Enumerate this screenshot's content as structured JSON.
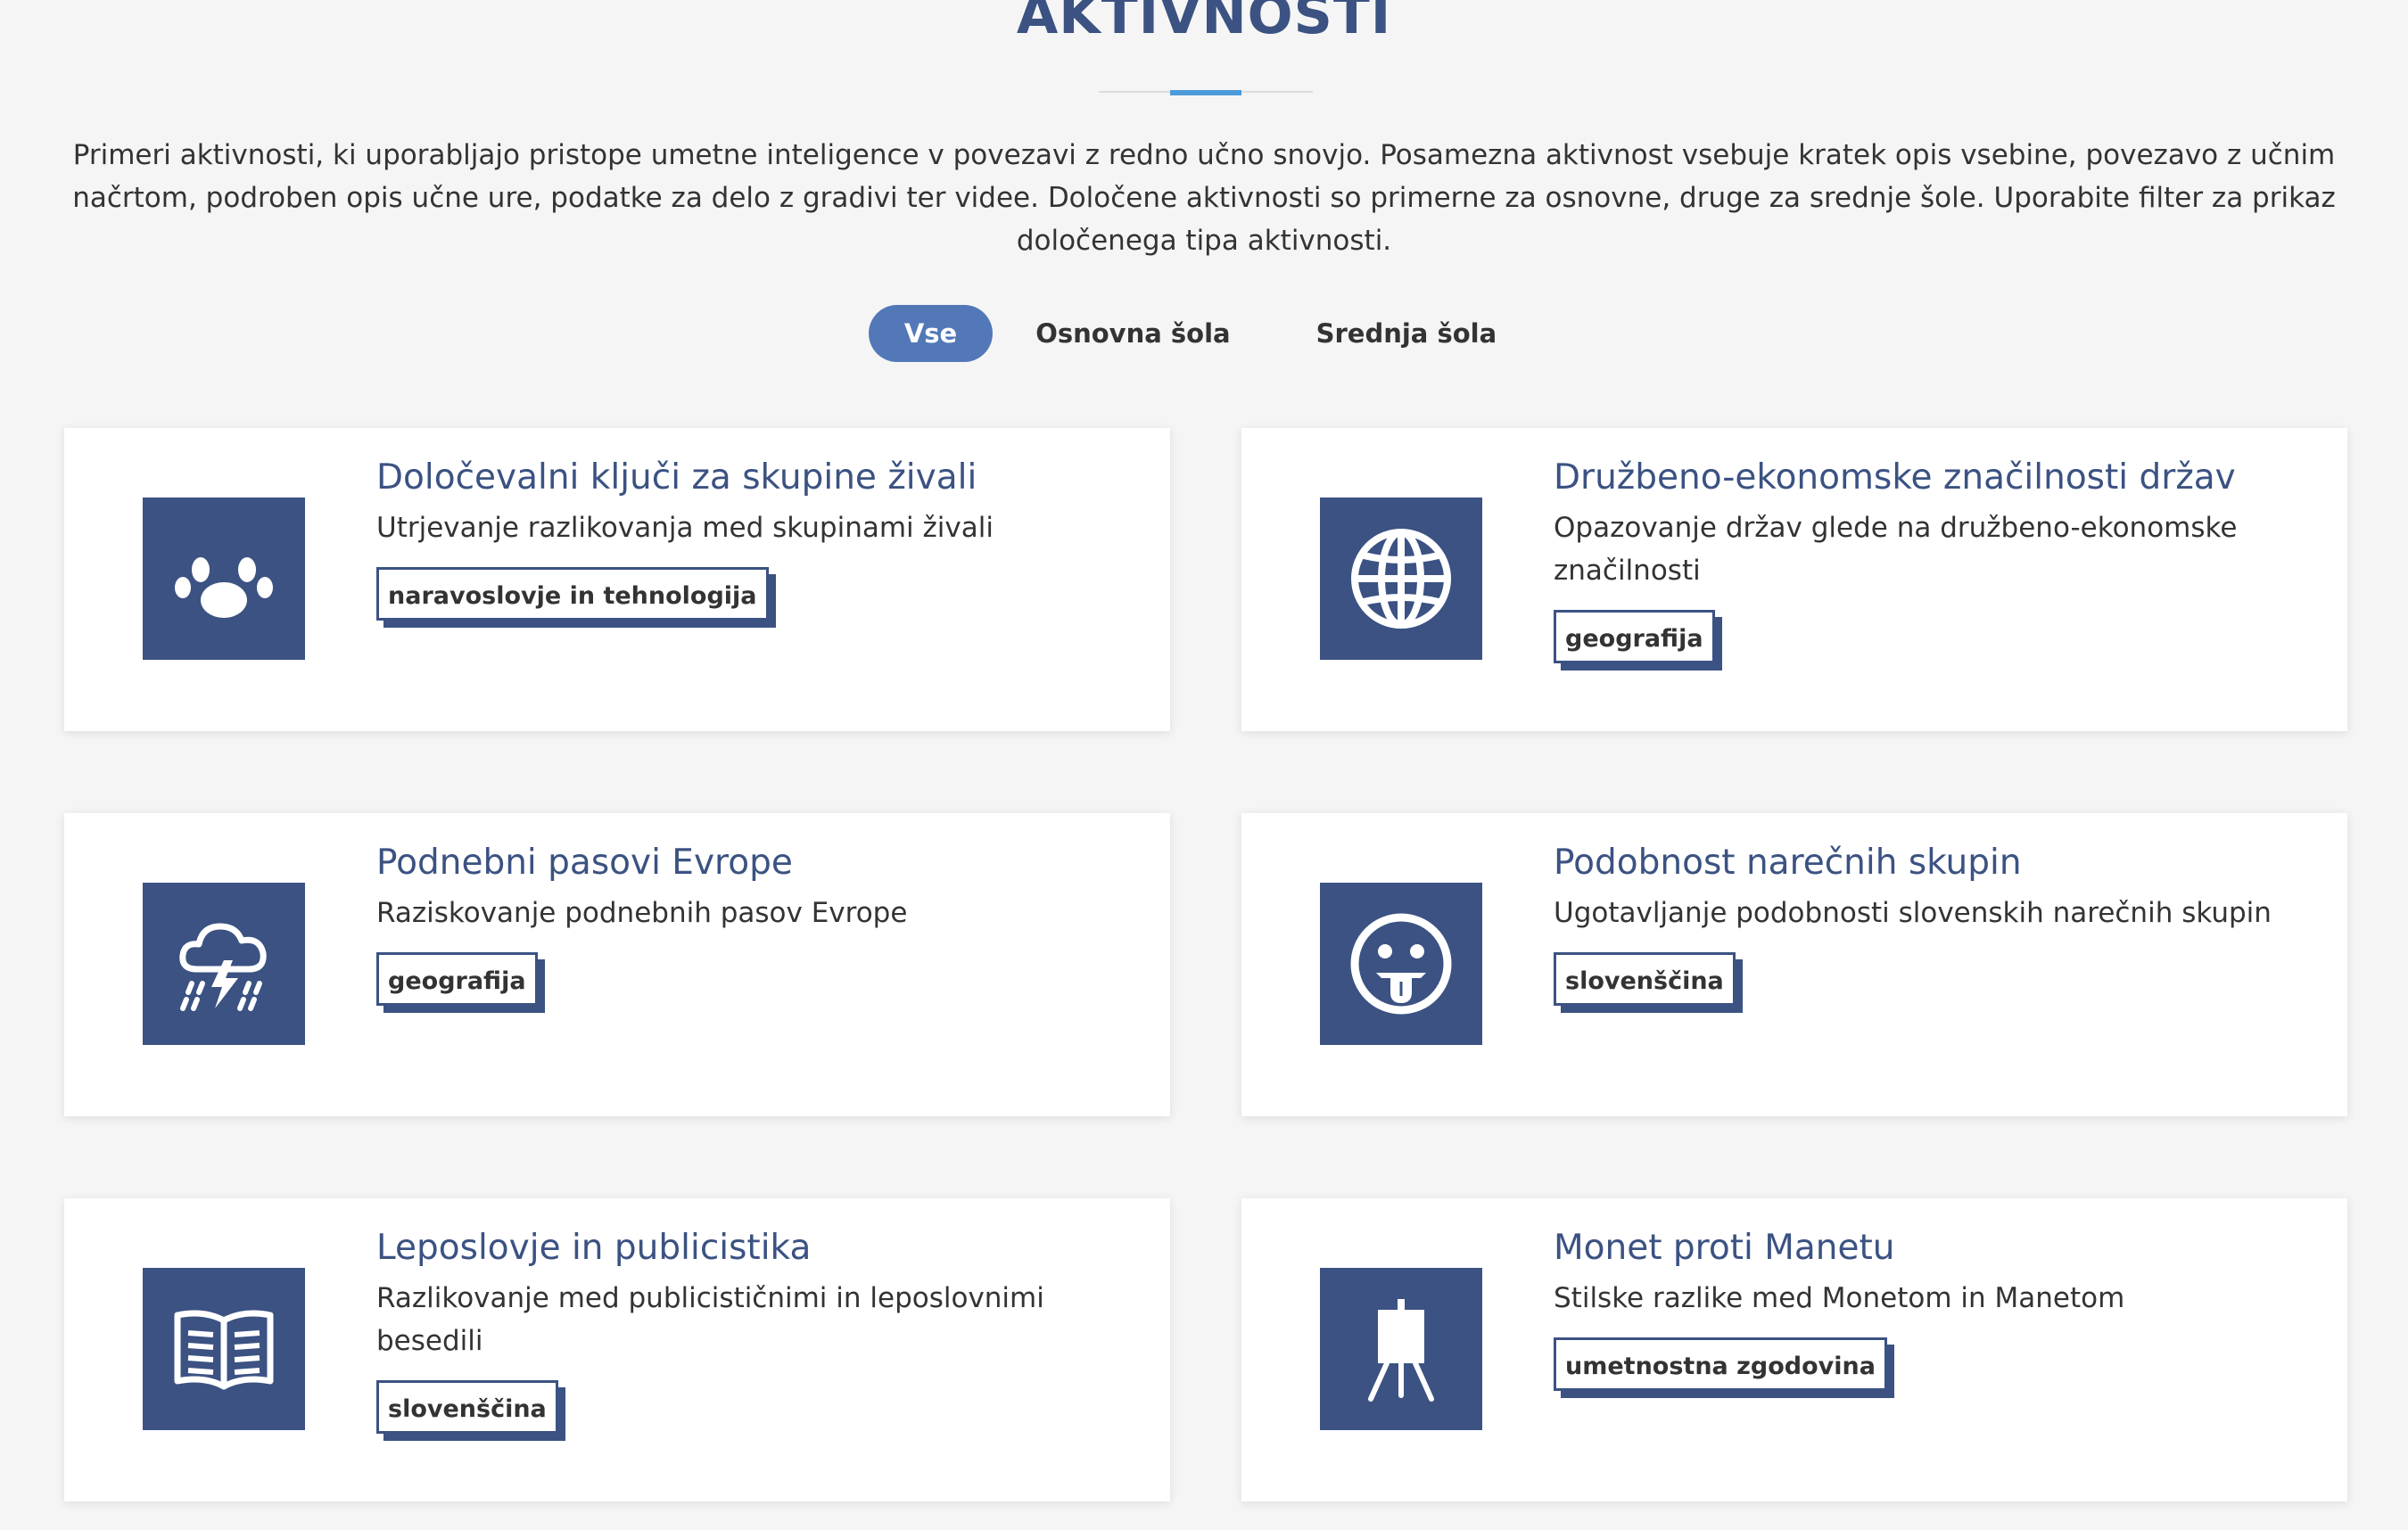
{
  "page": {
    "title": "AKTIVNOSTI",
    "intro": "Primeri aktivnosti, ki uporabljajo pristope umetne inteligence v povezavi z redno učno snovjo. Posamezna aktivnost vsebuje kratek opis vsebine, povezavo z učnim načrtom, podroben opis učne ure, podatke za delo z gradivi ter videe. Določene aktivnosti so primerne za osnovne, druge za srednje šole. Uporabite filter za prikaz določenega tipa aktivnosti."
  },
  "filters": {
    "items": [
      {
        "label": "Vse",
        "active": true
      },
      {
        "label": "Osnovna šola",
        "active": false
      },
      {
        "label": "Srednja šola",
        "active": false
      }
    ]
  },
  "colors": {
    "accent": "#3b5282",
    "filter_active": "#5278b8",
    "divider_accent": "#4a9bd8",
    "background": "#f5f5f5"
  },
  "cards": [
    {
      "title": "Določevalni ključi za skupine živali",
      "description": "Utrjevanje razlikovanja med skupinami živali",
      "tag": "naravoslovje in tehnologija",
      "icon": "paw-icon"
    },
    {
      "title": "Družbeno-ekonomske značilnosti držav",
      "description": "Opazovanje držav glede na družbeno-ekonomske značilnosti",
      "tag": "geografija",
      "icon": "globe-icon"
    },
    {
      "title": "Podnebni pasovi Evrope",
      "description": "Raziskovanje podnebnih pasov Evrope",
      "tag": "geografija",
      "icon": "storm-cloud-icon"
    },
    {
      "title": "Podobnost narečnih skupin",
      "description": "Ugotavljanje podobnosti slovenskih narečnih skupin",
      "tag": "slovenščina",
      "icon": "tongue-smiley-icon"
    },
    {
      "title": "Leposlovje in publicistika",
      "description": "Razlikovanje med publicističnimi in leposlovnimi besedili",
      "tag": "slovenščina",
      "icon": "open-book-icon"
    },
    {
      "title": "Monet proti Manetu",
      "description": "Stilske razlike med Monetom in Manetom",
      "tag": "umetnostna zgodovina",
      "icon": "easel-icon"
    }
  ]
}
